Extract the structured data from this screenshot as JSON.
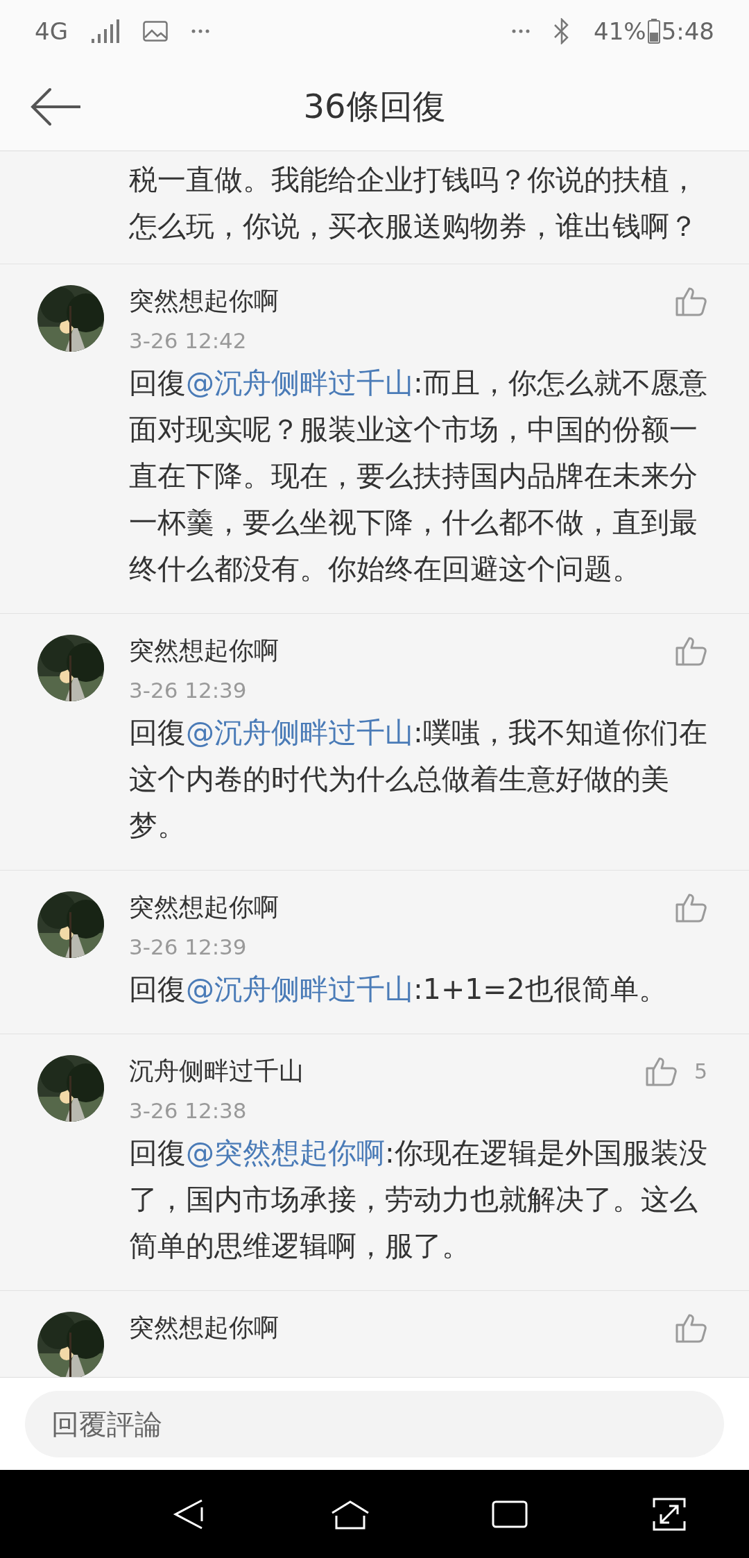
{
  "status_bar": {
    "network": "4G",
    "battery": "41%",
    "time": "5:48"
  },
  "header": {
    "title": "36條回復"
  },
  "comments": [
    {
      "kind": "partial",
      "text": "税一直做。我能给企业打钱吗？你说的扶植，怎么玩，你说，买衣服送购物券，谁出钱啊？"
    },
    {
      "kind": "full",
      "name": "突然想起你啊",
      "time": "3-26 12:42",
      "reply_prefix": "回復",
      "mention": "@沉舟侧畔过千山",
      "text": ":而且，你怎么就不愿意面对现实呢？服装业这个市场，中国的份额一直在下降。现在，要么扶持国内品牌在未来分一杯羹，要么坐视下降，什么都不做，直到最终什么都没有。你始终在回避这个问题。"
    },
    {
      "kind": "full",
      "name": "突然想起你啊",
      "time": "3-26 12:39",
      "reply_prefix": "回復",
      "mention": "@沉舟侧畔过千山",
      "text": ":噗嗤，我不知道你们在这个内卷的时代为什么总做着生意好做的美梦。"
    },
    {
      "kind": "full",
      "name": "突然想起你啊",
      "time": "3-26 12:39",
      "reply_prefix": "回復",
      "mention": "@沉舟侧畔过千山",
      "text": ":1+1=2也很简单。"
    },
    {
      "kind": "full",
      "name": "沉舟侧畔过千山",
      "time": "3-26 12:38",
      "likes": "5",
      "reply_prefix": "回復",
      "mention": "@突然想起你啊",
      "text": ":你现在逻辑是外国服装没了，国内市场承接，劳动力也就解决了。这么简单的思维逻辑啊，服了。"
    },
    {
      "kind": "cut",
      "name": "突然想起你啊"
    }
  ],
  "reply_field": {
    "placeholder": "回覆評論"
  }
}
